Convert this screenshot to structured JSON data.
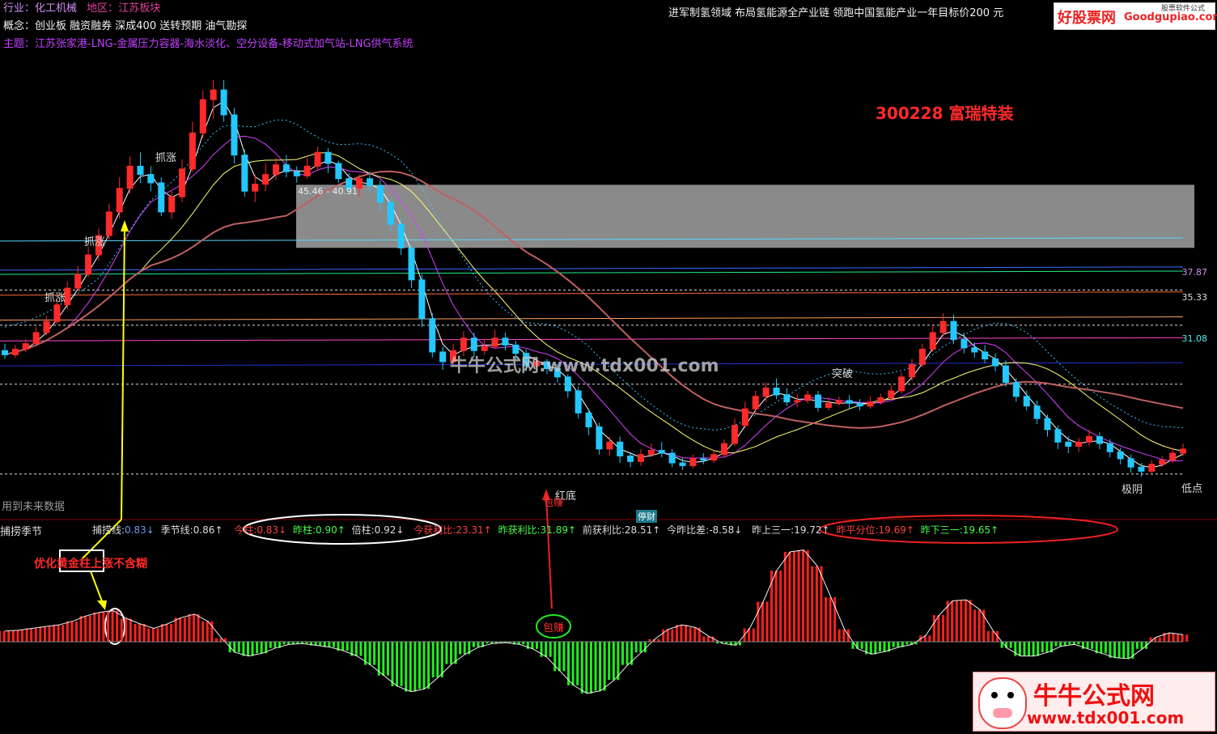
{
  "header": {
    "industry_label": "行业：",
    "industry_value": "化工机械",
    "region_label": "地区：",
    "region_value": "江苏板块",
    "concept_label": "概念：",
    "concept_value": "创业板 融资融券 深成400 送转预期 油气勘探",
    "theme_label": "主题：",
    "theme_value": "江苏张家港-LNG-金属压力容器-海水淡化、空分设备-移动式加气站-LNG供气系统",
    "headline": "进军制氢领域 布局氢能源全产业链 领跑中国氢能产业一年目标价200 元"
  },
  "logo": {
    "main": "好股票网",
    "sub": "Goodgupiao.com",
    "corner": "股票软件公式"
  },
  "stock_title": "300228 富瑞特装",
  "range_label": "45.46 - 40.91",
  "labels": {
    "zhuazhang": "抓涨",
    "tupo": "突破",
    "hongdi": "红底",
    "baozhuan": "包赚",
    "jiyin": "极阴",
    "didian": "低点",
    "future_data": "用到未来数据",
    "tingcai": "停财",
    "annotation_gold": "优化黄金柱上涨不含糊",
    "watermark_mid": "牛牛公式网:www.tdx001.com"
  },
  "indicator_bar": {
    "name": "捕捞季节",
    "items": [
      {
        "label": "捕捞线:",
        "value": "0.83↓",
        "color": "#6b9cf0"
      },
      {
        "label": "季节线:",
        "value": "0.86↑",
        "color": "#ddd"
      },
      {
        "label": "今柱:",
        "value": "0.83↓",
        "color": "#ff4040"
      },
      {
        "label": "昨柱:",
        "value": "0.90↑",
        "color": "#4f4"
      },
      {
        "label": "倍柱:",
        "value": "0.92↓",
        "color": "#ddd"
      },
      {
        "label": "今获利比:",
        "value": "23.31↑",
        "color": "#ff4040"
      },
      {
        "label": "昨获利比:",
        "value": "31.89↑",
        "color": "#4f4"
      },
      {
        "label": "前获利比:",
        "value": "28.51↑",
        "color": "#ddd"
      },
      {
        "label": "今昨比差:",
        "value": "-8.58↓",
        "color": "#ddd"
      },
      {
        "label": "昨上三一:",
        "value": "19.72↑",
        "color": "#ddd"
      },
      {
        "label": "昨平分位:",
        "value": "19.69↑",
        "color": "#ff4040"
      },
      {
        "label": "昨下三一:",
        "value": "19.65↑",
        "color": "#4f4"
      }
    ]
  },
  "price_axis": [
    {
      "label": "37.87"
    },
    {
      "label": "35.33"
    },
    {
      "label": "31.08"
    }
  ],
  "watermark": {
    "title": "牛牛公式网",
    "url": "www.tdx001.com"
  },
  "colors": {
    "up": "#ff2a2a",
    "down": "#22c8ff",
    "bg": "#000000",
    "green": "#22ee22"
  },
  "chart_data": {
    "type": "candlestick",
    "title": "300228 富瑞特装",
    "candles": [
      [
        33.5,
        33.2,
        34,
        32.9
      ],
      [
        33.2,
        33.6,
        33.9,
        33
      ],
      [
        33.6,
        34,
        34.3,
        33.4
      ],
      [
        34,
        34.8,
        35.2,
        33.9
      ],
      [
        34.8,
        35.6,
        36,
        34.6
      ],
      [
        35.6,
        36.8,
        37.2,
        35.4
      ],
      [
        36.8,
        38,
        38.5,
        36.5
      ],
      [
        38,
        39,
        39.6,
        37.8
      ],
      [
        39,
        40.4,
        41,
        38.8
      ],
      [
        40.4,
        41.8,
        42.3,
        40
      ],
      [
        41.8,
        43.5,
        44.1,
        41.5
      ],
      [
        43.5,
        45.2,
        46,
        43
      ],
      [
        45.2,
        46.8,
        47.5,
        44.8
      ],
      [
        46.8,
        46.2,
        47.8,
        45.6
      ],
      [
        46.2,
        45.6,
        46.8,
        45
      ],
      [
        45.6,
        43.5,
        46,
        43.2
      ],
      [
        43.5,
        44.6,
        45,
        43
      ],
      [
        44.6,
        46.6,
        47.3,
        44.2
      ],
      [
        46.6,
        49.2,
        50,
        46.4
      ],
      [
        49.2,
        51.6,
        52.3,
        48.8
      ],
      [
        51.6,
        52.3,
        53,
        50.2
      ],
      [
        52.3,
        50.5,
        53,
        50
      ],
      [
        50.5,
        47.6,
        51,
        47
      ],
      [
        47.6,
        45,
        48,
        44.6
      ],
      [
        45,
        45.5,
        46.2,
        44.2
      ],
      [
        45.5,
        46.2,
        47,
        45
      ],
      [
        46.2,
        46.9,
        47.4,
        45.8
      ],
      [
        46.9,
        46.4,
        47.6,
        46
      ],
      [
        46.4,
        46.1,
        46.8,
        45.6
      ],
      [
        46.1,
        46.8,
        47.4,
        45.9
      ],
      [
        46.8,
        47.8,
        48.2,
        46.5
      ],
      [
        47.8,
        47,
        48.1,
        46.3
      ],
      [
        47,
        45.9,
        47.2,
        45.6
      ],
      [
        45.9,
        45.2,
        46.3,
        44.8
      ],
      [
        45.2,
        45.9,
        46.2,
        44.6
      ],
      [
        45.9,
        45.4,
        46.4,
        44.9
      ],
      [
        45.4,
        44.2,
        45.8,
        43.6
      ],
      [
        44.2,
        42.6,
        44.5,
        42.1
      ],
      [
        42.6,
        40.9,
        43,
        40.4
      ],
      [
        40.9,
        38.6,
        41.2,
        38
      ],
      [
        38.6,
        35.8,
        39,
        35.2
      ],
      [
        35.8,
        33.4,
        36.2,
        33
      ],
      [
        33.4,
        32.7,
        33.8,
        32.1
      ],
      [
        32.7,
        33.5,
        34,
        32.4
      ],
      [
        33.5,
        34.4,
        34.9,
        33.1
      ],
      [
        34.4,
        33.5,
        34.8,
        33
      ],
      [
        33.5,
        33.8,
        34.3,
        33.2
      ],
      [
        33.8,
        34.4,
        35,
        33.6
      ],
      [
        34.4,
        33.9,
        34.8,
        33.5
      ],
      [
        33.9,
        33.3,
        34.2,
        32.9
      ],
      [
        33.3,
        32.4,
        33.6,
        32
      ],
      [
        32.4,
        32.7,
        33,
        32.1
      ],
      [
        32.7,
        32.2,
        32.9,
        31.8
      ],
      [
        32.2,
        31.6,
        32.5,
        31.2
      ],
      [
        31.6,
        30.6,
        31.8,
        30.1
      ],
      [
        30.6,
        29,
        30.9,
        28.6
      ],
      [
        29,
        28,
        29.3,
        27.4
      ],
      [
        28,
        26.4,
        28.3,
        26
      ],
      [
        26.4,
        26.9,
        27.3,
        25.9
      ],
      [
        26.9,
        25.9,
        27.3,
        25.4
      ],
      [
        25.9,
        25.5,
        26.2,
        25.1
      ],
      [
        25.5,
        26,
        26.4,
        25.2
      ],
      [
        26,
        26.3,
        26.8,
        25.8
      ],
      [
        26.3,
        26.1,
        26.9,
        25.8
      ],
      [
        26.1,
        25.4,
        26.4,
        25.1
      ],
      [
        25.4,
        25.2,
        25.8,
        24.9
      ],
      [
        25.2,
        25.7,
        26,
        25
      ],
      [
        25.7,
        25.6,
        26.1,
        25.3
      ],
      [
        25.6,
        26,
        26.3,
        25.4
      ],
      [
        26,
        26.8,
        27.1,
        25.8
      ],
      [
        26.8,
        28.1,
        28.6,
        26.6
      ],
      [
        28.1,
        29.3,
        29.8,
        27.9
      ],
      [
        29.3,
        30.2,
        30.6,
        29
      ],
      [
        30.2,
        30.8,
        31.2,
        29.8
      ],
      [
        30.8,
        30.3,
        31.5,
        30
      ],
      [
        30.3,
        29.8,
        30.8,
        29.5
      ],
      [
        29.8,
        29.9,
        30.4,
        29.4
      ],
      [
        29.9,
        30.3,
        30.6,
        29.7
      ],
      [
        30.3,
        29.4,
        30.6,
        29.1
      ],
      [
        29.4,
        29.7,
        30.1,
        29.2
      ],
      [
        29.7,
        29.9,
        30.2,
        29.5
      ],
      [
        29.9,
        29.7,
        30.3,
        29.3
      ],
      [
        29.7,
        29.5,
        30,
        29.2
      ],
      [
        29.5,
        29.8,
        30.2,
        29.3
      ],
      [
        29.8,
        30.1,
        30.4,
        29.6
      ],
      [
        30.1,
        30.6,
        31,
        29.9
      ],
      [
        30.6,
        31.6,
        31.9,
        30.4
      ],
      [
        31.6,
        32.5,
        32.9,
        31.3
      ],
      [
        32.5,
        33.6,
        34,
        32.3
      ],
      [
        33.6,
        34.8,
        35.3,
        33.4
      ],
      [
        34.8,
        35.6,
        36.2,
        34.5
      ],
      [
        35.6,
        34.3,
        36.1,
        34
      ],
      [
        34.3,
        33.7,
        34.8,
        33.3
      ],
      [
        33.7,
        33.4,
        34.1,
        33
      ],
      [
        33.4,
        32.9,
        33.9,
        32.6
      ],
      [
        32.9,
        32.4,
        33.3,
        32
      ],
      [
        32.4,
        31.2,
        32.8,
        30.9
      ],
      [
        31.2,
        30.2,
        31.5,
        29.8
      ],
      [
        30.2,
        29.5,
        30.6,
        29.2
      ],
      [
        29.5,
        28.6,
        29.9,
        28.2
      ],
      [
        28.6,
        27.8,
        28.9,
        27.3
      ],
      [
        27.8,
        26.9,
        28.1,
        26.4
      ],
      [
        26.9,
        26.6,
        27.3,
        26.1
      ],
      [
        26.6,
        26.9,
        27.2,
        26.2
      ],
      [
        26.9,
        27.3,
        27.8,
        26.6
      ],
      [
        27.3,
        26.8,
        27.6,
        26.4
      ],
      [
        26.8,
        26.2,
        27.1,
        25.8
      ],
      [
        26.2,
        25.7,
        26.5,
        25.3
      ],
      [
        25.7,
        25.1,
        26,
        24.7
      ],
      [
        25.1,
        24.8,
        25.4,
        24.4
      ],
      [
        24.8,
        25.3,
        25.6,
        24.5
      ],
      [
        25.3,
        25.6,
        25.9,
        25.1
      ],
      [
        25.6,
        26.1,
        26.5,
        25.4
      ],
      [
        26.1,
        26.4,
        26.8,
        25.9
      ]
    ],
    "ylim": [
      24,
      54
    ],
    "price_levels": [
      37.87,
      35.33,
      31.08
    ],
    "resistance_zone": [
      40.91,
      45.46
    ],
    "oscillator": [
      1.2,
      1.3,
      1.5,
      1.7,
      1.9,
      2.3,
      2.9,
      3.3,
      3.5,
      2.6,
      2.0,
      1.5,
      2.0,
      2.7,
      3.1,
      2.3,
      0.4,
      -1.2,
      -1.6,
      -1.3,
      -0.7,
      -0.3,
      -0.2,
      -0.4,
      -0.6,
      -1.0,
      -1.6,
      -2.6,
      -3.8,
      -5.0,
      -5.6,
      -5.3,
      -4.0,
      -2.5,
      -1.4,
      -0.6,
      -0.2,
      -0.1,
      -0.3,
      -0.8,
      -1.7,
      -3.3,
      -4.9,
      -5.8,
      -5.5,
      -4.3,
      -2.6,
      -1.2,
      0.3,
      1.4,
      1.9,
      1.6,
      0.6,
      -0.2,
      -0.4,
      1.5,
      4.5,
      8.0,
      10.1,
      10.3,
      8.5,
      5.0,
      1.4,
      -0.8,
      -1.4,
      -1.1,
      -0.6,
      -0.3,
      0.7,
      3.0,
      4.6,
      4.7,
      3.6,
      1.2,
      -0.7,
      -1.6,
      -1.6,
      -1.2,
      -0.5,
      -0.3,
      -0.8,
      -1.3,
      -1.8,
      -1.9,
      -0.8,
      0.5,
      1.0,
      0.8
    ]
  }
}
